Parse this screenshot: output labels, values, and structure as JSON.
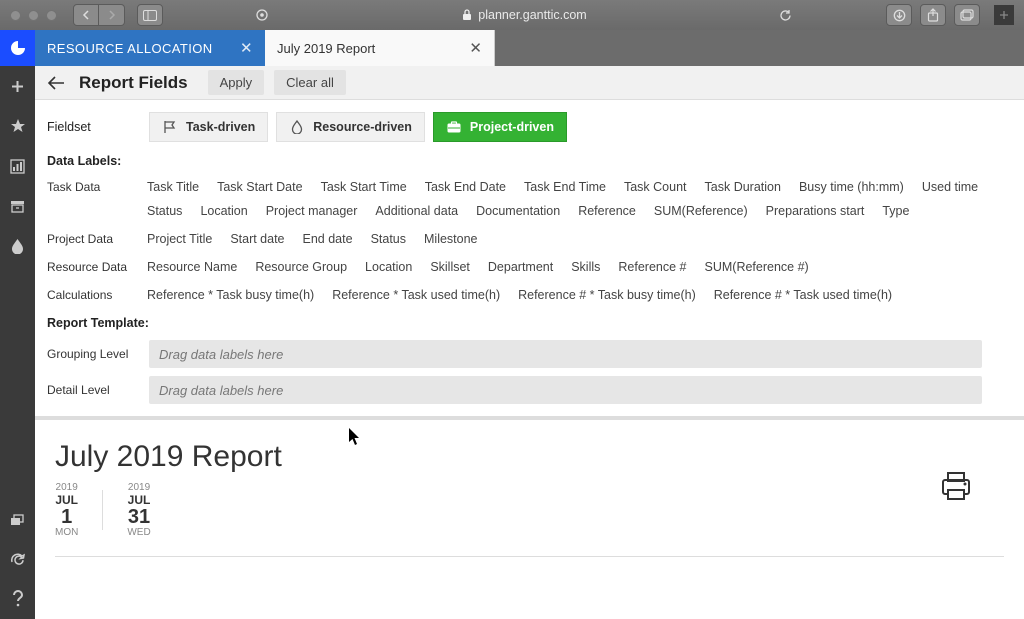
{
  "browser": {
    "url_host": "planner.ganttic.com"
  },
  "tabs": {
    "tab1": "RESOURCE ALLOCATION",
    "tab2": "July 2019 Report"
  },
  "header": {
    "title": "Report Fields",
    "apply": "Apply",
    "clear": "Clear all"
  },
  "fieldset": {
    "label": "Fieldset",
    "task": "Task-driven",
    "resource": "Resource-driven",
    "project": "Project-driven"
  },
  "sections": {
    "data_labels": "Data Labels:",
    "report_template": "Report Template:"
  },
  "categories": {
    "task": "Task Data",
    "project": "Project Data",
    "resource": "Resource Data",
    "calc": "Calculations"
  },
  "tags": {
    "task": [
      "Task Title",
      "Task Start Date",
      "Task Start Time",
      "Task End Date",
      "Task End Time",
      "Task Count",
      "Task Duration",
      "Busy time (hh:mm)",
      "Used time",
      "Status",
      "Location",
      "Project manager",
      "Additional data",
      "Documentation",
      "Reference",
      "SUM(Reference)",
      "Preparations start",
      "Type"
    ],
    "project": [
      "Project Title",
      "Start date",
      "End date",
      "Status",
      "Milestone"
    ],
    "resource": [
      "Resource Name",
      "Resource Group",
      "Location",
      "Skillset",
      "Department",
      "Skills",
      "Reference #",
      "SUM(Reference #)"
    ],
    "calc": [
      "Reference * Task busy time(h)",
      "Reference * Task used time(h)",
      "Reference # * Task busy time(h)",
      "Reference # * Task used time(h)"
    ]
  },
  "template": {
    "grouping_label": "Grouping Level",
    "detail_label": "Detail Level",
    "dropzone_placeholder": "Drag data labels here"
  },
  "report": {
    "title": "July 2019 Report",
    "start": {
      "year": "2019",
      "month": "JUL",
      "day": "1",
      "weekday": "MON"
    },
    "end": {
      "year": "2019",
      "month": "JUL",
      "day": "31",
      "weekday": "WED"
    }
  }
}
